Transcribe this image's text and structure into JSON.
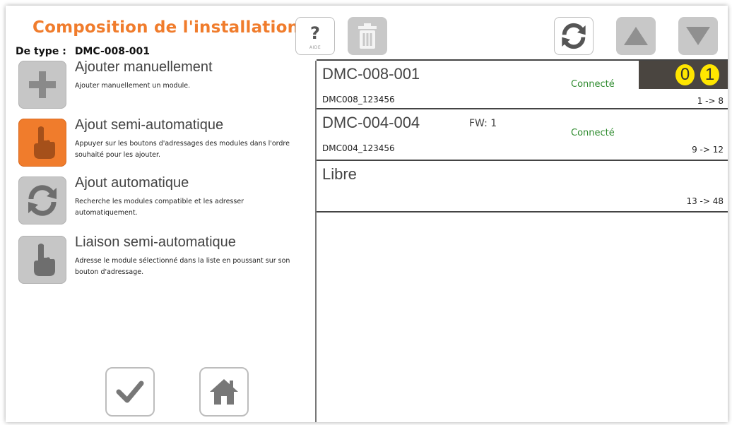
{
  "header": {
    "title": "Composition de l'installation",
    "type_label": "De type :",
    "type_value": "DMC-008-001"
  },
  "actions": [
    {
      "name": "Ajouter manuellement",
      "desc": "Ajouter manuellement un module.",
      "icon": "plus-icon",
      "active": false
    },
    {
      "name": "Ajout semi-automatique",
      "desc": "Appuyer sur les boutons d'adressages des modules dans l'ordre souhaité pour les ajouter.",
      "icon": "hand-pointer-icon",
      "active": true
    },
    {
      "name": "Ajout automatique",
      "desc": "Recherche les modules compatible et les adresser automatiquement.",
      "icon": "refresh-icon",
      "active": false
    },
    {
      "name": "Liaison semi-automatique",
      "desc": "Adresse le module sélectionné dans la liste en poussant sur son bouton d'adressage.",
      "icon": "hand-pointer-icon",
      "active": false
    }
  ],
  "toolbar": {
    "help_symbol": "?",
    "help_label": "AIDE"
  },
  "modules": [
    {
      "model": "DMC-008-001",
      "fw": "",
      "status": "Connecté",
      "serial": "DMC008_123456",
      "range": "1 -> 8",
      "address_digits": [
        "0",
        "1"
      ]
    },
    {
      "model": "DMC-004-004",
      "fw": "FW: 1",
      "status": "Connecté",
      "serial": "DMC004_123456",
      "range": "9 -> 12"
    },
    {
      "model": "Libre",
      "fw": "",
      "status": "",
      "serial": "",
      "range": "13 -> 48"
    }
  ],
  "colors": {
    "accent_orange": "#f07c2c",
    "button_grey": "#c6c6c6",
    "status_green": "#2e8b2e",
    "address_digit_yellow": "#ffe600"
  }
}
